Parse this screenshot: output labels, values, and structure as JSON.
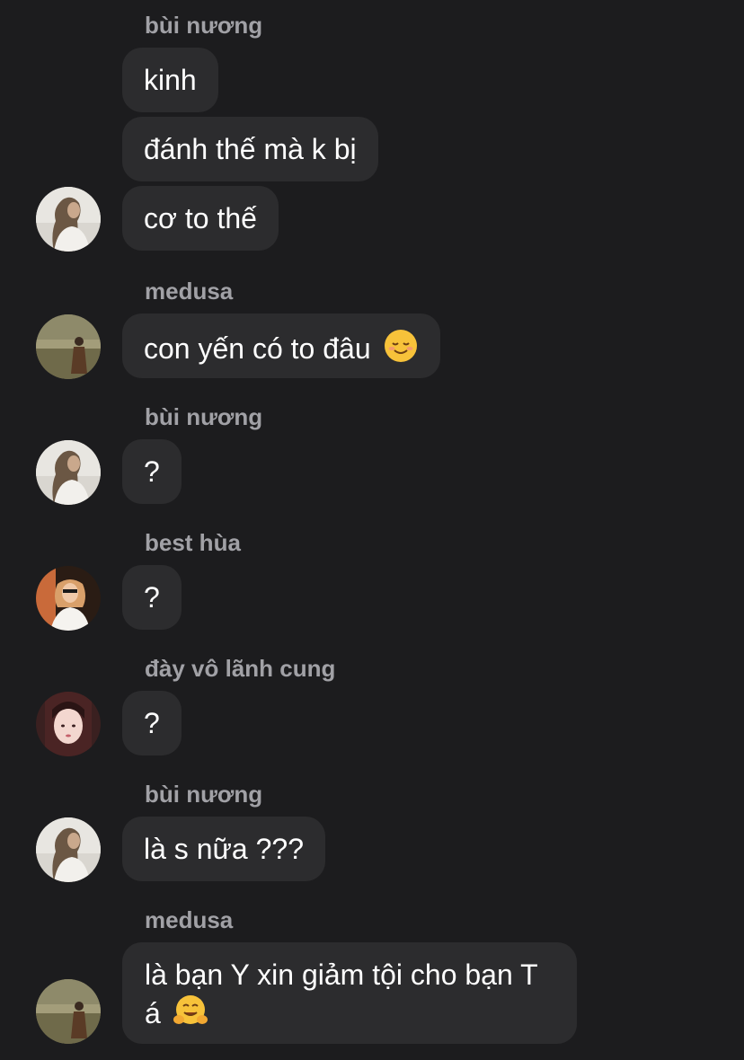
{
  "messages": [
    {
      "sender": "bùi nương",
      "lines": [
        "kinh",
        "đánh thế mà k bị",
        "cơ to thế"
      ]
    },
    {
      "sender": "medusa",
      "lines": [
        "con yến có to đâu"
      ],
      "emoji": "relieved-smile-emoji"
    },
    {
      "sender": "bùi nương",
      "lines": [
        "?"
      ]
    },
    {
      "sender": "best hùa",
      "lines": [
        "?"
      ]
    },
    {
      "sender": "đày vô lãnh cung",
      "lines": [
        "?"
      ]
    },
    {
      "sender": "bùi nương",
      "lines": [
        "là s nữa ???"
      ]
    },
    {
      "sender": "medusa",
      "lines": [
        "là bạn Y xin giảm tội cho bạn T á"
      ],
      "emoji": "hugging-face-emoji"
    }
  ],
  "theme": {
    "background": "#1c1c1e",
    "bubble": "#2c2c2e",
    "sender_name": "#a1a1a6",
    "text": "#ffffff"
  }
}
